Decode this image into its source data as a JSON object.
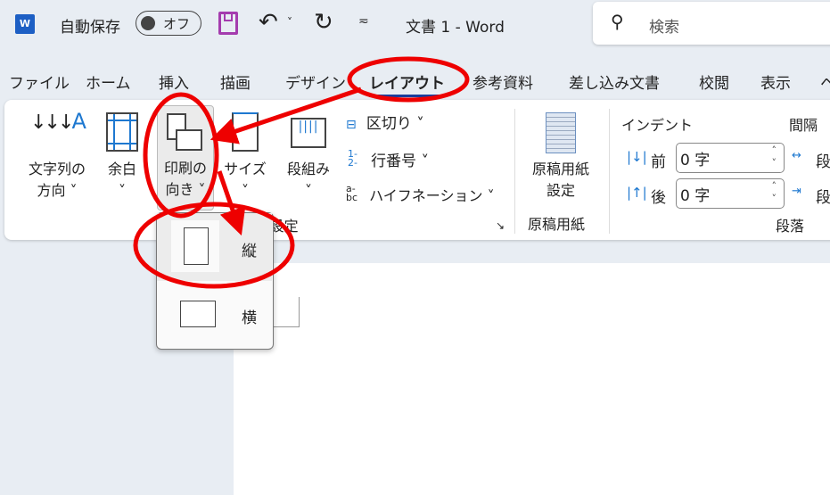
{
  "titlebar": {
    "autosave_label": "自動保存",
    "autosave_state": "オフ",
    "title": "文書 1 - Word",
    "search_placeholder": "検索"
  },
  "tabs": [
    "ファイル",
    "ホーム",
    "挿入",
    "描画",
    "デザイン",
    "レイアウト",
    "参考資料",
    "差し込み文書",
    "校閲",
    "表示",
    "ヘ"
  ],
  "active_tab": "レイアウト",
  "ribbon": {
    "text_direction": [
      "文字列の",
      "方向 ˅"
    ],
    "margins": [
      "余白",
      "˅"
    ],
    "orientation": [
      "印刷の",
      "向き ˅"
    ],
    "size": [
      "サイズ",
      "˅"
    ],
    "columns": [
      "段組み",
      "˅"
    ],
    "breaks": "区切り ˅",
    "line_numbers": "行番号 ˅",
    "hyphenation": "ハイフネーション ˅",
    "page_setup_group": "ページ設定",
    "manuscript": [
      "原稿用紙",
      "設定"
    ],
    "manuscript_group": "原稿用紙",
    "indent_header": "インデント",
    "spacing_header": "間隔",
    "indent_before_label": "前",
    "indent_before_value": "0 字",
    "indent_after_label": "後",
    "indent_after_value": "0 字",
    "spacing_before_label": "段",
    "spacing_after_label": "段",
    "paragraph_group": "段落"
  },
  "orientation_menu": {
    "portrait": "縦",
    "landscape": "横"
  },
  "colors": {
    "annotation": "#ee0000",
    "accent": "#1e78d0",
    "tab_underline": "#1a3d9c"
  }
}
